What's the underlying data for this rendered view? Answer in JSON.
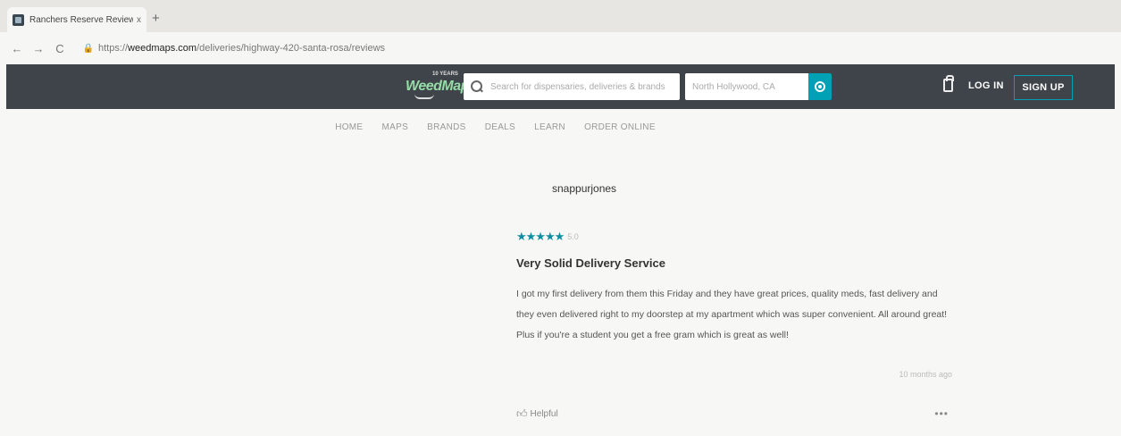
{
  "browser": {
    "tab_title": "Ranchers Reserve Reviews - C",
    "tab_close": "x",
    "new_tab": "+",
    "nav": {
      "back": "←",
      "forward": "→",
      "reload": "C"
    },
    "lock": "🔒",
    "url_scheme": "https://",
    "url_host": "weedmaps.com",
    "url_path": "/deliveries/highway-420-santa-rosa/reviews"
  },
  "header": {
    "logo_text": "WeedMaps",
    "logo_years": "10 YEARS",
    "search_placeholder": "Search for dispensaries, deliveries & brands",
    "location_placeholder": "North Hollywood, CA",
    "login_label": "LOG IN",
    "signup_label": "SIGN UP"
  },
  "nav_items": [
    "HOME",
    "MAPS",
    "BRANDS",
    "DEALS",
    "LEARN",
    "ORDER ONLINE"
  ],
  "review": {
    "reviewer": "snappurjones",
    "stars": "★★★★★",
    "rating": 5.0,
    "rating_label": "5.0",
    "title": "Very Solid Delivery Service",
    "body": "I got my first delivery from them this Friday and they have great prices, quality meds, fast delivery and they even delivered right to my doorstep at my apartment which was super convenient. All around great! Plus if you're a student you get a free gram which is great as well!",
    "time_ago": "10 months ago",
    "helpful_label": "Helpful",
    "more_label": "•••"
  },
  "colors": {
    "header_bg": "#3e4449",
    "accent": "#00a1b5",
    "star_color": "#0e8ea3"
  }
}
